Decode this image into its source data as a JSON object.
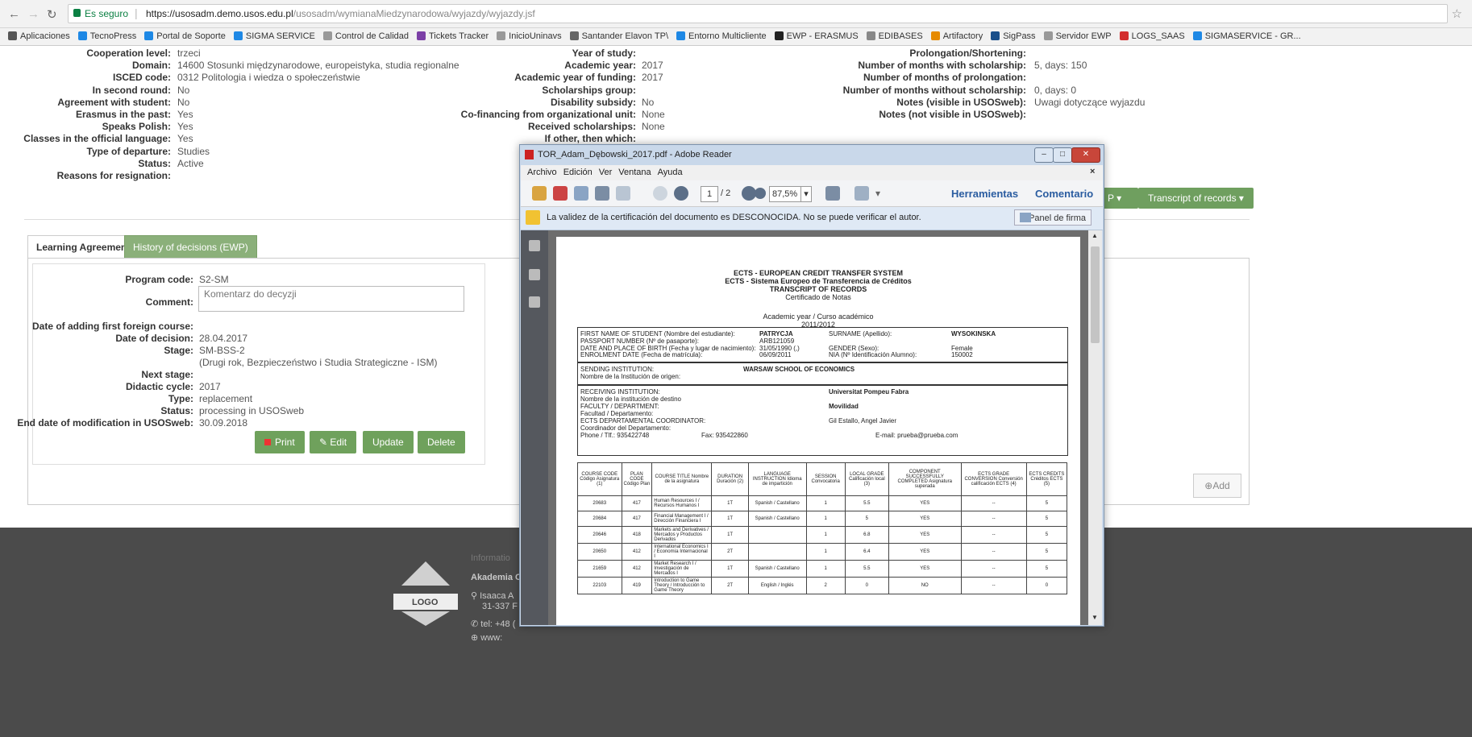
{
  "browser": {
    "secure_label": "Es seguro",
    "url_host": "https://usosadm.demo.usos.edu.pl",
    "url_path": "/usosadm/wymianaMiedzynarodowa/wyjazdy/wyjazdy.jsf",
    "bookmarks": [
      "Aplicaciones",
      "TecnoPress",
      "Portal de Soporte",
      "SIGMA SERVICE",
      "Control de Calidad",
      "Tickets Tracker",
      "InicioUninavs",
      "Santander Elavon TP\\",
      "Entorno Multicliente",
      "EWP - ERASMUS",
      "EDIBASES",
      "Artifactory",
      "SigPass",
      "Servidor EWP",
      "LOGS_SAAS",
      "SIGMASERVICE - GR..."
    ]
  },
  "info_left": [
    {
      "label": "Cooperation level:",
      "value": "trzeci"
    },
    {
      "label": "Domain:",
      "value": "14600 Stosunki międzynarodowe, europeistyka, studia regionalne"
    },
    {
      "label": "ISCED code:",
      "value": "0312 Politologia i wiedza o społeczeństwie"
    },
    {
      "label": "In second round:",
      "value": "No"
    },
    {
      "label": "Agreement with student:",
      "value": "No"
    },
    {
      "label": "Erasmus in the past:",
      "value": "Yes"
    },
    {
      "label": "Speaks Polish:",
      "value": "Yes"
    },
    {
      "label": "Classes in the official language:",
      "value": "Yes"
    },
    {
      "label": "Type of departure:",
      "value": "Studies"
    },
    {
      "label": "Status:",
      "value": "Active"
    },
    {
      "label": "Reasons for resignation:",
      "value": ""
    }
  ],
  "info_mid": [
    {
      "label": "Year of study:",
      "value": ""
    },
    {
      "label": "Academic year:",
      "value": "2017"
    },
    {
      "label": "Academic year of funding:",
      "value": "2017"
    },
    {
      "label": "Scholarships group:",
      "value": ""
    },
    {
      "label": "Disability subsidy:",
      "value": "No"
    },
    {
      "label": "Co-financing from organizational unit:",
      "value": "None"
    },
    {
      "label": "Received scholarships:",
      "value": "None"
    },
    {
      "label": "If other, then which:",
      "value": ""
    }
  ],
  "info_right": [
    {
      "label": "Prolongation/Shortening:",
      "value": ""
    },
    {
      "label": "Number of months with scholarship:",
      "value": "5, days: 150"
    },
    {
      "label": "Number of months of prolongation:",
      "value": ""
    },
    {
      "label": "Number of months without scholarship:",
      "value": "0, days: 0"
    },
    {
      "label": "Notes (visible in USOSweb):",
      "value": "Uwagi dotyczące wyjazdu"
    },
    {
      "label": "Notes (not visible in USOSweb):",
      "value": ""
    }
  ],
  "top_buttons": {
    "p_label": "P ▾",
    "transcript": "Transcript of records ▾"
  },
  "tabs": {
    "learning": "Learning Agreement",
    "history": "History of decisions (EWP)"
  },
  "decision": {
    "rows": [
      {
        "label": "Program code:",
        "value": "S2-SM"
      },
      {
        "label": "Comment:",
        "value": ""
      },
      {
        "label": "Date of adding first foreign course:",
        "value": ""
      },
      {
        "label": "Date of decision:",
        "value": "28.04.2017"
      },
      {
        "label": "Stage:",
        "value": "SM-BSS-2"
      },
      {
        "label": "",
        "value": "(Drugi rok, Bezpieczeństwo i Studia Strategiczne - ISM)"
      },
      {
        "label": "Next stage:",
        "value": ""
      },
      {
        "label": "Didactic cycle:",
        "value": "2017"
      },
      {
        "label": "Type:",
        "value": "replacement"
      },
      {
        "label": "Status:",
        "value": "processing in USOSweb"
      },
      {
        "label": "End date of modification in USOSweb:",
        "value": "30.09.2018"
      }
    ],
    "comment_text": "Komentarz do decyzji",
    "buttons": {
      "print": "Print",
      "edit": "Edit",
      "update": "Update",
      "delete": "Delete"
    },
    "add": "Add"
  },
  "footer": {
    "info": "Informatio",
    "org": "Akademia C",
    "addr1": "Isaaca A",
    "addr2": "31-337 F",
    "tel": "tel: +48 (",
    "www": "www:",
    "logo": "LOGO"
  },
  "adobe": {
    "title": "TOR_Adam_Dębowski_2017.pdf - Adobe Reader",
    "menu": [
      "Archivo",
      "Edición",
      "Ver",
      "Ventana",
      "Ayuda"
    ],
    "page": "1",
    "pages": "/ 2",
    "zoom": "87,5%",
    "tools": "Herramientas",
    "comment": "Comentario",
    "warning": "La validez de la certificación del documento es DESCONOCIDA. No se puede verificar el autor.",
    "sign_panel": "Panel de firma",
    "doc": {
      "h1": "ECTS - EUROPEAN CREDIT TRANSFER SYSTEM",
      "h2": "ECTS - Sistema Europeo de Transferencia de Créditos",
      "h3": "TRANSCRIPT OF RECORDS",
      "h4": "Certificado de Notas",
      "ay_label": "Academic year / Curso académico",
      "ay": "2011/2012",
      "fn_label": "FIRST NAME OF STUDENT (Nombre del estudiante):",
      "fn": "PATRYCJA",
      "sn_label": "SURNAME (Apellido):",
      "sn": "WYSOKINSKA",
      "pp_label": "PASSPORT NUMBER (Nº de pasaporte):",
      "pp": "ARB121059",
      "dob_label": "DATE AND PLACE OF BIRTH (Fecha y lugar de nacimiento):",
      "dob": "31/05/1990  (,)",
      "gender_label": "GENDER (Sexo):",
      "gender": "Female",
      "enr_label": "ENROLMENT DATE (Fecha de matrícula):",
      "enr": "06/09/2011",
      "nia_label": "NIA (Nº Identificación Alumno):",
      "nia": "150002",
      "send_label": "SENDING INSTITUTION:",
      "send_sub": "Nombre de la Institución de origen:",
      "send": "WARSAW SCHOOL OF ECONOMICS",
      "recv_label": "RECEIVING INSTITUTION:",
      "recv_sub": "Nombre de la institución de destino",
      "recv": "Universitat Pompeu Fabra",
      "fac_label": "FACULTY / DEPARTMENT:",
      "fac_sub": "Facultad / Departamento:",
      "fac": "Movilidad",
      "coord_label": "ECTS DEPARTAMENTAL COORDINATOR:",
      "coord_sub": "Coordinador del Departamento:",
      "coord": "Gil Estallo,  Angel Javier",
      "phone": "Phone / Tlf.: 935422748",
      "fax": "Fax: 935422860",
      "email": "E-mail: prueba@prueba.com",
      "headers": [
        "COURSE CODE Código Asignatura (1)",
        "PLAN CODE Código Plan",
        "COURSE TITLE Nombre de la asignatura",
        "DURATION Duración (2)",
        "LANGUAGE INSTRUCTION Idioma de impartición",
        "SESSION Convocatoria",
        "LOCAL GRADE Calificación local (3)",
        "COMPONENT SUCCESSFULLY COMPLETED Asignatura superada",
        "ECTS GRADE CONVERSION Conversión calificación ECTS (4)",
        "ECTS CREDITS Créditos ECTS (5)"
      ],
      "rows": [
        [
          "20683",
          "417",
          "Human Resources I / Recursos Humanos I",
          "1T",
          "Spanish / Castellano",
          "1",
          "5.5",
          "YES",
          "--",
          "5"
        ],
        [
          "20684",
          "417",
          "Financial Management I / Dirección Financiera I",
          "1T",
          "Spanish / Castellano",
          "1",
          "5",
          "YES",
          "--",
          "5"
        ],
        [
          "20646",
          "418",
          "Markets and Derivatives / Mercados y Productos Derivados",
          "1T",
          "",
          "1",
          "6.8",
          "YES",
          "--",
          "5"
        ],
        [
          "20650",
          "412",
          "International Economics I / Economía Internacional I",
          "2T",
          "",
          "1",
          "6.4",
          "YES",
          "--",
          "5"
        ],
        [
          "21659",
          "412",
          "Market Research I / Investigación de Mercados I",
          "1T",
          "Spanish / Castellano",
          "1",
          "5.5",
          "YES",
          "--",
          "5"
        ],
        [
          "22103",
          "419",
          "Introduction to Game Theory / Introducción to Game Theory",
          "2T",
          "English / Inglés",
          "2",
          "0",
          "NO",
          "--",
          "0"
        ]
      ]
    }
  },
  "colors": {
    "green": "#6fa15c",
    "adobe_frame": "#c9d8ea",
    "footer": "#4b4b4b",
    "link_blue": "#2a5ca0"
  }
}
